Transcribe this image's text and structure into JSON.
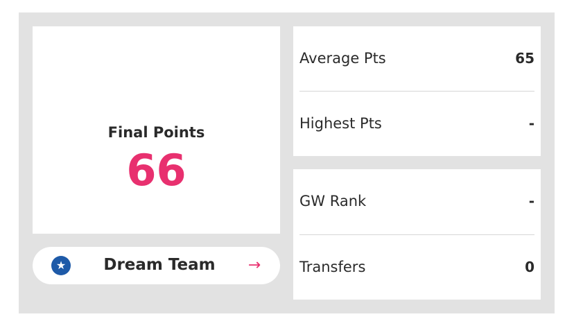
{
  "final_points": {
    "label": "Final Points",
    "value": "66"
  },
  "dream_team": {
    "label": "Dream Team",
    "star_icon": "★",
    "arrow_icon": "→"
  },
  "stats": [
    {
      "label": "Average Pts",
      "value": "65"
    },
    {
      "label": "Highest Pts",
      "value": "-"
    },
    {
      "label": "GW Rank",
      "value": "-"
    },
    {
      "label": "Transfers",
      "value": "0"
    }
  ],
  "colors": {
    "accent": "#e8306f",
    "star_badge": "#1e5aa8",
    "panel_bg": "#e2e2e2"
  }
}
